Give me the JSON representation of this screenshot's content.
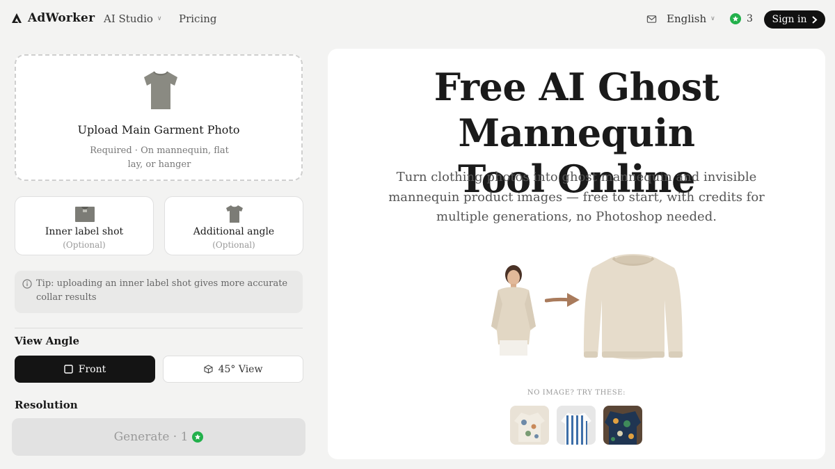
{
  "header": {
    "logo_text": "AdWorker",
    "nav": {
      "studio": "AI Studio",
      "pricing": "Pricing"
    },
    "language": "English",
    "credits": "3",
    "signin": "Sign in"
  },
  "upload": {
    "title": "Upload Main Garment Photo",
    "subtitle": "Required · On mannequin, flat lay, or hanger"
  },
  "optional_uploads": [
    {
      "label": "Inner label shot",
      "sub": "(Optional)"
    },
    {
      "label": "Additional angle",
      "sub": "(Optional)"
    }
  ],
  "tip": "Tip: uploading an inner label shot gives more accurate collar results",
  "view_angle": {
    "label": "View Angle",
    "options": [
      "Front",
      "45° View"
    ],
    "selected": "Front"
  },
  "resolution": {
    "label": "Resolution"
  },
  "generate": {
    "label": "Generate · 1"
  },
  "hero": {
    "title_line1": "Free AI Ghost Mannequin",
    "title_line2": "Tool Online",
    "subtitle": "Turn clothing photos into ghost mannequin and invisible mannequin product images — free to start, with credits for multiple generations, no Photoshop needed.",
    "try_label": "NO IMAGE? TRY THESE:"
  },
  "colors": {
    "accent_dark": "#141414",
    "credit_green": "#22b04b",
    "background": "#f3f3f2"
  },
  "icons": [
    "logo-icon",
    "chevron-down-icon",
    "mail-icon",
    "credit-star-icon",
    "chevron-right-icon",
    "tshirt-icon",
    "label-icon",
    "info-icon",
    "square-icon",
    "cube-icon",
    "arrow-right-icon"
  ]
}
